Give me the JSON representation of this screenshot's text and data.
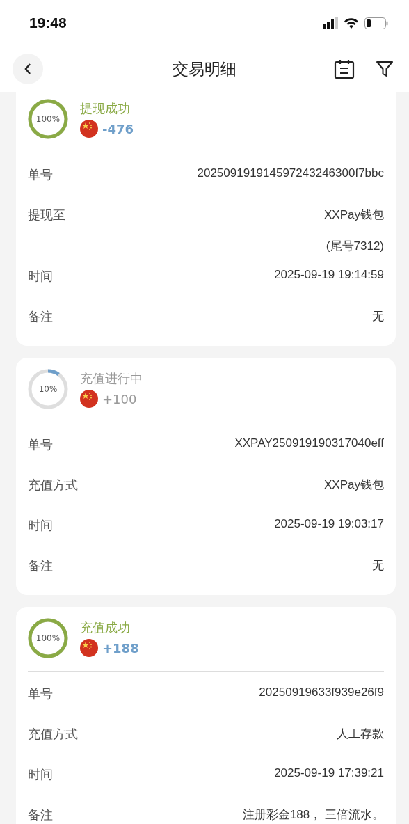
{
  "status_bar": {
    "time": "19:48"
  },
  "header": {
    "title": "交易明细"
  },
  "transactions": [
    {
      "status": "提现成功",
      "completed": true,
      "level": 1,
      "percent": "100%",
      "amount": "-476",
      "fields": [
        {
          "label": "单号",
          "values": [
            "202509191914597243246300f7bbc"
          ]
        },
        {
          "label": "提现至",
          "values": [
            "XXPay钱包",
            "(尾号7312)"
          ]
        },
        {
          "label": "时间",
          "values": [
            "2025-09-19 19:14:59"
          ]
        },
        {
          "label": "备注",
          "values": [
            "无"
          ]
        }
      ]
    },
    {
      "status": "充值进行中",
      "completed": false,
      "level": 0.1,
      "percent": "10%",
      "amount": "+100",
      "fields": [
        {
          "label": "单号",
          "values": [
            "XXPAY250919190317040eff"
          ]
        },
        {
          "label": "充值方式",
          "values": [
            "XXPay钱包"
          ]
        },
        {
          "label": "时间",
          "values": [
            "2025-09-19 19:03:17"
          ]
        },
        {
          "label": "备注",
          "values": [
            "无"
          ]
        }
      ]
    },
    {
      "status": "充值成功",
      "completed": true,
      "level": 1,
      "percent": "100%",
      "amount": "+188",
      "fields": [
        {
          "label": "单号",
          "values": [
            "20250919633f939e26f9"
          ]
        },
        {
          "label": "充值方式",
          "values": [
            "人工存款"
          ]
        },
        {
          "label": "时间",
          "values": [
            "2025-09-19 17:39:21"
          ]
        },
        {
          "label": "备注",
          "values": [
            "注册彩金188， 三倍流水。"
          ]
        }
      ]
    }
  ]
}
